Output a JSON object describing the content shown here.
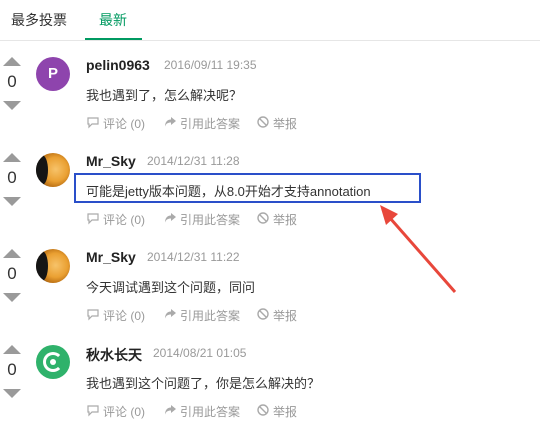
{
  "tabs": {
    "most_votes": "最多投票",
    "newest": "最新"
  },
  "answers": [
    {
      "votes": "0",
      "username": "pelin0963",
      "time": "2016/09/11 19:35",
      "content": "我也遇到了，怎么解决呢？",
      "avatar_letter": "P",
      "comment": "评论 (0)",
      "cite": "引用此答案",
      "report": "举报"
    },
    {
      "votes": "0",
      "username": "Mr_Sky",
      "time": "2014/12/31 11:28",
      "content": "可能是jetty版本问题，从8.0开始才支持annotation",
      "comment": "评论 (0)",
      "cite": "引用此答案",
      "report": "举报"
    },
    {
      "votes": "0",
      "username": "Mr_Sky",
      "time": "2014/12/31 11:22",
      "content": "今天调试遇到这个问题，同问",
      "comment": "评论 (0)",
      "cite": "引用此答案",
      "report": "举报"
    },
    {
      "votes": "0",
      "username": "秋水长天",
      "time": "2014/08/21 01:05",
      "content": "我也遇到这个问题了，你是怎么解决的？",
      "comment": "评论 (0)",
      "cite": "引用此答案",
      "report": "举报"
    }
  ],
  "colors": {
    "accent": "#009a61",
    "highlight_box": "#2a4fc9",
    "arrow": "#e8473b"
  },
  "icons": {
    "comment": "speech-bubble-icon",
    "cite": "share-arrow-icon",
    "report": "ban-icon",
    "vote_up": "triangle-up-icon",
    "vote_down": "triangle-down-icon"
  }
}
